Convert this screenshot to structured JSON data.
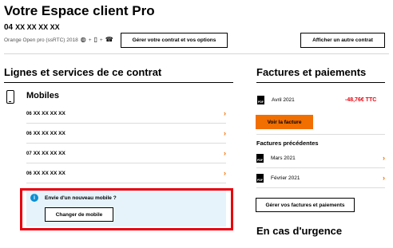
{
  "header": {
    "title": "Votre Espace client Pro",
    "number_prefix": "04",
    "number_mask": "XX XX XX XX",
    "offer": "Orange Open pro (ssRTC) 2018",
    "plus_sep": "+",
    "manage_button": "Gérer votre contrat et vos options",
    "other_button": "Afficher un autre contrat"
  },
  "lines_section": {
    "title": "Lignes et services de ce contrat",
    "mobiles_title": "Mobiles",
    "lines": [
      {
        "prefix": "06",
        "mask": "XX XX XX XX"
      },
      {
        "prefix": "06",
        "mask": "XX XX XX XX"
      },
      {
        "prefix": "07",
        "mask": "XX XX XX XX"
      },
      {
        "prefix": "06",
        "mask": "XX XX XX XX"
      }
    ],
    "promo": {
      "question": "Envie d'un nouveau mobile ?",
      "button": "Changer de mobile"
    }
  },
  "billing": {
    "title": "Factures et paiements",
    "latest": {
      "date": "Avril 2021",
      "amount": "-48,76€ TTC"
    },
    "view_button": "Voir la facture",
    "previous_title": "Factures précédentes",
    "previous": [
      {
        "date": "Mars 2021"
      },
      {
        "date": "Février 2021"
      }
    ],
    "manage_button": "Gérer vos factures et paiements"
  },
  "urgent": {
    "title": "En cas d'urgence"
  },
  "icons": {
    "pdf_label": "PDF",
    "info": "i",
    "chevron": "›",
    "accent_color": "#f16e00",
    "alert_color": "#e8000b",
    "info_color": "#0b8fd4"
  }
}
